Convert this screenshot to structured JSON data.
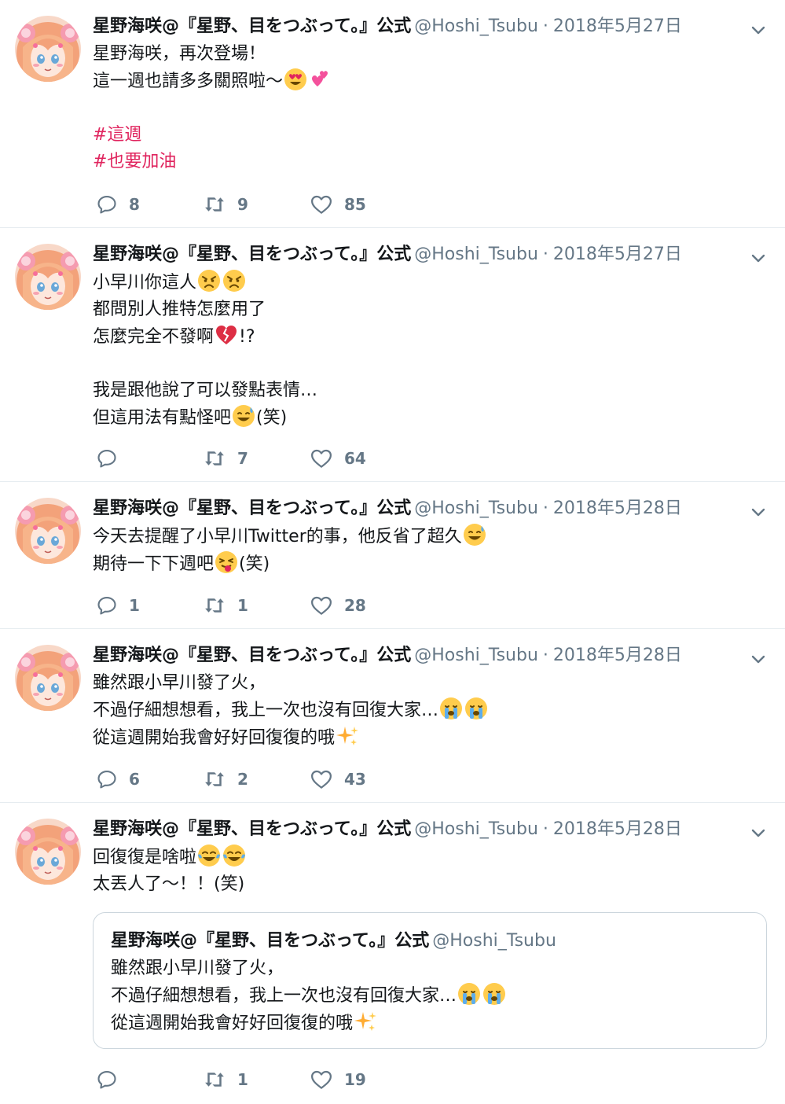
{
  "author": {
    "name": "星野海咲@『星野、目をつぶって。』公式",
    "handle": "@Hoshi_Tsubu",
    "separator": "·"
  },
  "colors": {
    "hashtag": "#e0245e",
    "muted": "#657786",
    "border": "#e6ecf0"
  },
  "tweets": [
    {
      "date": "2018年5月27日",
      "lines": [
        "星野海咲，再次登場！",
        "這一週也請多多關照啦～",
        "",
        "#這週",
        "#也要加油"
      ],
      "emojis": [
        "heart-eyes-emoji",
        "two-hearts-emoji"
      ],
      "reply_count": "8",
      "retweet_count": "9",
      "like_count": "85"
    },
    {
      "date": "2018年5月27日",
      "lines": [
        "小早川你這人",
        "都問別人推特怎麼用了",
        "怎麼完全不發啊",
        "",
        "我是跟他說了可以發點表情…",
        "但這用法有點怪吧"
      ],
      "tails": {
        "l3": "!?",
        "l6": "(笑)"
      },
      "emojis": [
        "angry-emoji",
        "broken-heart-emoji",
        "sweat-smile-emoji"
      ],
      "reply_count": "",
      "retweet_count": "7",
      "like_count": "64"
    },
    {
      "date": "2018年5月28日",
      "lines": [
        "今天去提醒了小早川Twitter的事，他反省了超久",
        "期待一下下週吧"
      ],
      "tails": {
        "l2": "(笑)"
      },
      "emojis": [
        "sweat-smile-emoji",
        "tongue-wink-emoji"
      ],
      "reply_count": "1",
      "retweet_count": "1",
      "like_count": "28"
    },
    {
      "date": "2018年5月28日",
      "lines": [
        "雖然跟小早川發了火，",
        "不過仔細想想看，我上一次也沒有回復大家…",
        "從這週開始我會好好回復復的哦"
      ],
      "emojis": [
        "crying-emoji",
        "sparkles-emoji"
      ],
      "reply_count": "6",
      "retweet_count": "2",
      "like_count": "43"
    },
    {
      "date": "2018年5月28日",
      "lines": [
        "回復復是啥啦",
        "太丟人了～！！(笑)"
      ],
      "emojis": [
        "tears-of-joy-emoji"
      ],
      "quote": {
        "name": "星野海咲@『星野、目をつぶって。』公式",
        "handle": "@Hoshi_Tsubu",
        "lines": [
          "雖然跟小早川發了火，",
          "不過仔細想想看，我上一次也沒有回復大家…",
          "從這週開始我會好好回復復的哦"
        ]
      },
      "reply_count": "",
      "retweet_count": "1",
      "like_count": "19"
    }
  ]
}
